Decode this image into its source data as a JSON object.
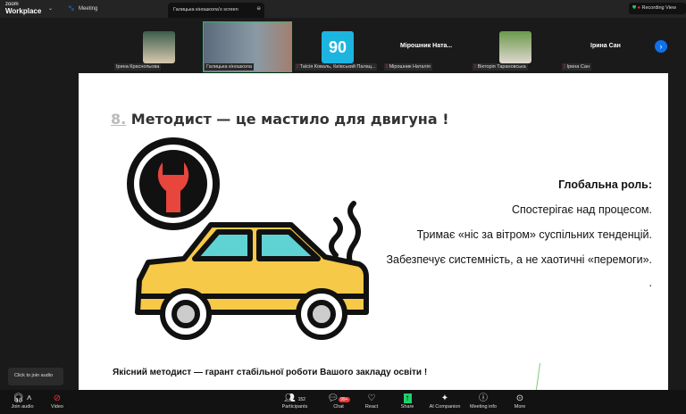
{
  "topbar": {
    "logo_small": "zoom",
    "logo_big": "Workplace",
    "meeting": "Meeting",
    "screen_tab": "Галицька кіношкола's screen",
    "recording": "Recording",
    "view": "View"
  },
  "participants_strip": [
    {
      "name": "Ірина Краснопьова",
      "type": "video"
    },
    {
      "name": "Галицька кіношкола",
      "type": "video",
      "active": true
    },
    {
      "name": "Таїсія Коваль, Київський Палац...",
      "type": "logo"
    },
    {
      "name": "Мірошник Наталія",
      "display": "Мірошник Ната...",
      "type": "name"
    },
    {
      "name": "Вікторія Тарановська",
      "type": "video"
    },
    {
      "name": "Ірина Сан",
      "display": "Ірина Сан",
      "type": "name"
    }
  ],
  "slide": {
    "title_num": "8.",
    "title": "Методист — це мастило для двигуна !",
    "role_heading": "Глобальна роль:",
    "lines": [
      "Спостерігає над процесом.",
      "Тримає «ніс за вітром» суспільних тенденцій.",
      "Забезпечує системність, а не хаотичні «перемоги».",
      "."
    ],
    "footer": "Якісний методист — гарант стабільної роботи Вашого закладу освіти !"
  },
  "tooltip": "Click to join audio",
  "toolbar": {
    "join_audio": "Join audio",
    "video": "Video",
    "participants": "Participants",
    "participants_count": "152",
    "chat": "Chat",
    "chat_badge": "99+",
    "react": "React",
    "share": "Share",
    "ai": "AI Companion",
    "info": "Meeting info",
    "more": "More"
  },
  "colors": {
    "accent": "#0e71eb",
    "share": "#1bd36b",
    "active_border": "#22c55e",
    "car": "#f7c948",
    "glass": "#5fd3d3",
    "wrench": "#e8453c"
  }
}
